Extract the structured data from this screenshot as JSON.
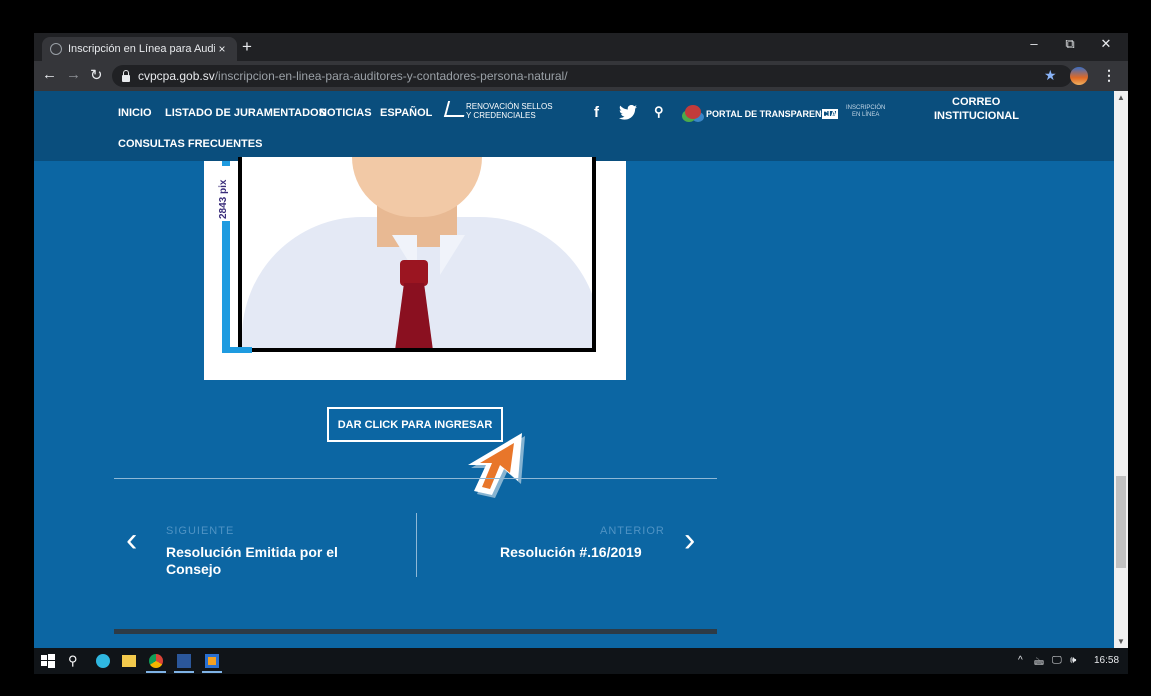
{
  "browser": {
    "tab_title": "Inscripción en Línea para Auditor",
    "tab_close": "×",
    "new_tab": "+",
    "url_host": "cvpcpa.gob.sv",
    "url_path": "/inscripcion-en-linea-para-auditores-y-contadores-persona-natural/",
    "window_controls": [
      "–",
      "⧉",
      "✕"
    ]
  },
  "site_nav": {
    "inicio": "INICIO",
    "juramentados": "LISTADO DE JURAMENTADOS",
    "noticias": "NOTICIAS",
    "idioma": "ESPAÑOL",
    "renovacion_line1": "RENOVACIÓN SELLOS",
    "renovacion_line2": "Y CREDENCIALES",
    "facebook": "f",
    "search": "⚲",
    "transparencia": "PORTAL DE TRANSPARENCIA",
    "inscripcion_line1": "INSCRIPCIÓN",
    "inscripcion_line2": "EN LÍNEA",
    "correo_line1": "CORREO",
    "correo_line2": "INSTITUCIONAL",
    "consultas": "CONSULTAS FRECUENTES"
  },
  "image_card": {
    "ruler_label": "2843 pix"
  },
  "cta_button": "DAR CLICK PARA INGRESAR",
  "post_nav": {
    "next_label": "SIGUIENTE",
    "next_title": "Resolución Emitida por el Consejo",
    "prev_label": "ANTERIOR",
    "prev_title": "Resolución #.16/2019"
  },
  "taskbar": {
    "time": "16:58",
    "tray_icons": [
      "^",
      "🖮",
      "🖵",
      "🕪"
    ]
  },
  "colors": {
    "page_bg": "#0c66a3",
    "header_bg": "#0a4e7d",
    "cursor_orange": "#e8762a"
  }
}
